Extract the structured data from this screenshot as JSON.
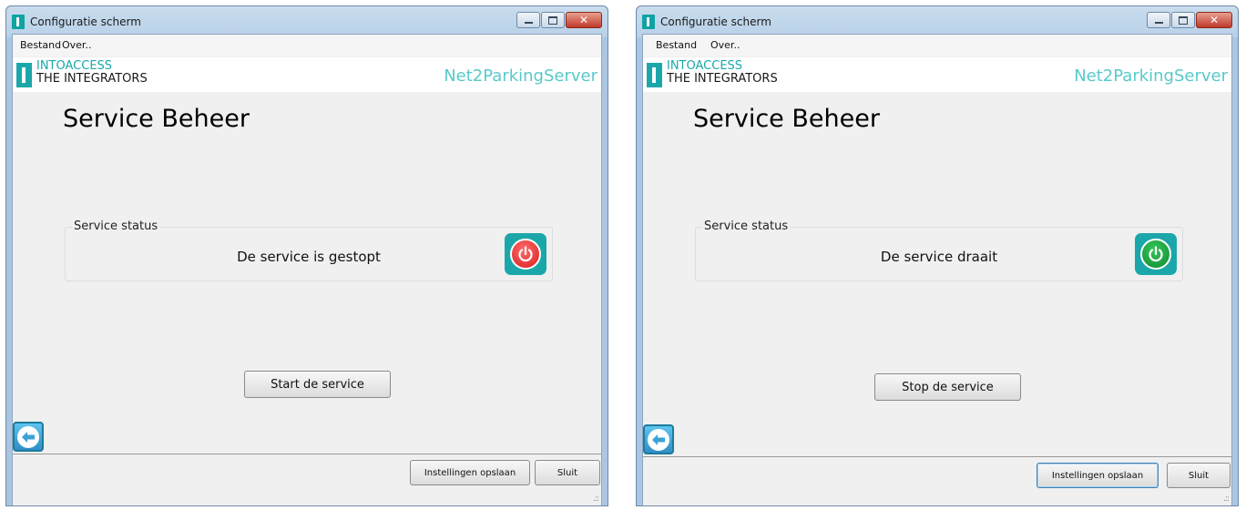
{
  "windows": [
    {
      "title": "Configuratie scherm",
      "menu": [
        "Bestand",
        "Over.."
      ],
      "brand": {
        "name": "INTOACCESS",
        "tagline": "THE INTEGRATORS"
      },
      "product": "Net2ParkingServer",
      "heading": "Service Beheer",
      "group_label": "Service status",
      "status_text": "De service is gestopt",
      "power_state": "stopped",
      "power_color": "#d81e1e",
      "action_label": "Start de service",
      "footer": {
        "save_label": "Instellingen opslaan",
        "close_label": "Sluit"
      },
      "back_icon": "arrow-left-icon",
      "power_icon": "power-icon"
    },
    {
      "title": "Configuratie scherm",
      "menu": [
        "Bestand",
        "Over.."
      ],
      "brand": {
        "name": "INTOACCESS",
        "tagline": "THE INTEGRATORS"
      },
      "product": "Net2ParkingServer",
      "heading": "Service Beheer",
      "group_label": "Service status",
      "status_text": "De service draait",
      "power_state": "running",
      "power_color": "#0f8a2f",
      "action_label": "Stop de service",
      "footer": {
        "save_label": "Instellingen opslaan",
        "close_label": "Sluit"
      },
      "back_icon": "arrow-left-icon",
      "power_icon": "power-icon"
    }
  ],
  "accent_color": "#1ba7a9",
  "product_color": "#59c9c9"
}
